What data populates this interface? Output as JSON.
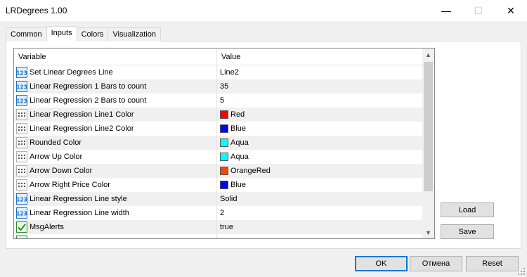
{
  "window": {
    "title": "LRDegrees 1.00",
    "min_glyph": "—",
    "max_glyph": "☐",
    "close_glyph": "✕"
  },
  "tabs": [
    {
      "label": "Common",
      "active": false
    },
    {
      "label": "Inputs",
      "active": true
    },
    {
      "label": "Colors",
      "active": false
    },
    {
      "label": "Visualization",
      "active": false
    }
  ],
  "grid": {
    "columns": {
      "variable": "Variable",
      "value": "Value"
    },
    "rows": [
      {
        "icon": "number-icon",
        "variable": "Set Linear Degrees Line",
        "value": "Line2"
      },
      {
        "icon": "number-icon",
        "variable": "Linear Regression  1 Bars to count",
        "value": "35"
      },
      {
        "icon": "number-icon",
        "variable": "Linear Regression  2 Bars to count",
        "value": "5"
      },
      {
        "icon": "color-icon",
        "variable": "Linear Regression Line1 Color",
        "value": "Red",
        "swatch": "#ff0000"
      },
      {
        "icon": "color-icon",
        "variable": "Linear Regression Line2 Color",
        "value": "Blue",
        "swatch": "#0000ff"
      },
      {
        "icon": "color-icon",
        "variable": "Rounded Color",
        "value": "Aqua",
        "swatch": "#00ffff"
      },
      {
        "icon": "color-icon",
        "variable": "Arrow Up Color",
        "value": "Aqua",
        "swatch": "#00ffff"
      },
      {
        "icon": "color-icon",
        "variable": "Arrow Down Color",
        "value": "OrangeRed",
        "swatch": "#ff4500"
      },
      {
        "icon": "color-icon",
        "variable": "Arrow Right Price  Color",
        "value": "Blue",
        "swatch": "#0000ff"
      },
      {
        "icon": "number-icon",
        "variable": "Linear Regression Line style",
        "value": "Solid"
      },
      {
        "icon": "number-icon",
        "variable": "Linear Regression Line width",
        "value": "2"
      },
      {
        "icon": "bool-icon",
        "variable": "MsgAlerts",
        "value": "true"
      },
      {
        "icon": "bool-icon",
        "variable": "",
        "value": ""
      }
    ],
    "scroll_up_glyph": "▲",
    "scroll_down_glyph": "▼"
  },
  "side_buttons": {
    "load": "Load",
    "save": "Save"
  },
  "bottom_buttons": {
    "ok": "OK",
    "cancel": "Отмена",
    "reset": "Reset"
  },
  "colors": {
    "accent": "#0078d7",
    "alt_row": "#f0f0f0",
    "bool_icon": "#2e8b2e",
    "number_icon": "#1e73c8"
  }
}
